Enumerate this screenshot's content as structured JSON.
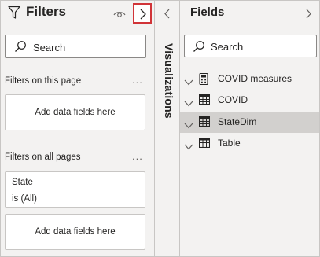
{
  "filters": {
    "title": "Filters",
    "search_placeholder": "Search",
    "sections": {
      "this_page": {
        "label": "Filters on this page",
        "more": "...",
        "well_text": "Add data fields here"
      },
      "all_pages": {
        "label": "Filters on all pages",
        "more": "...",
        "card": {
          "name": "State",
          "value": "is (All)"
        },
        "well_text": "Add data fields here"
      }
    }
  },
  "visualizations": {
    "label": "Visualizations"
  },
  "fields": {
    "title": "Fields",
    "search_placeholder": "Search",
    "tables": [
      {
        "name": "COVID measures",
        "icon": "calculator-icon",
        "selected": false
      },
      {
        "name": "COVID",
        "icon": "table-icon",
        "selected": false
      },
      {
        "name": "StateDim",
        "icon": "table-icon",
        "selected": true
      },
      {
        "name": "Table",
        "icon": "table-icon",
        "selected": false
      }
    ]
  },
  "colors": {
    "pane_background": "#f3f2f1",
    "highlight_border": "#d13438",
    "selected_row": "#d2d0ce",
    "border": "#c8c6c4"
  }
}
